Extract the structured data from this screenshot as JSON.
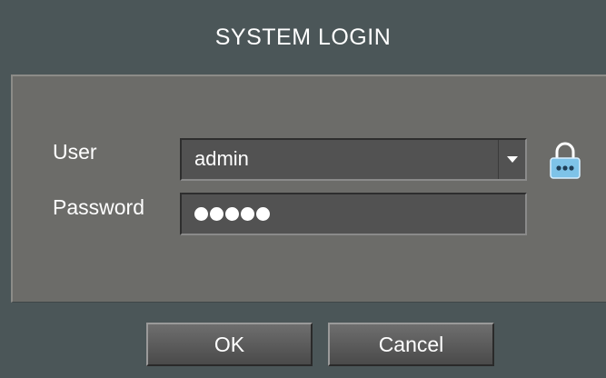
{
  "dialog": {
    "title": "SYSTEM LOGIN"
  },
  "form": {
    "user_label": "User",
    "user_value": "admin",
    "password_label": "Password",
    "password_masked_length": 5
  },
  "buttons": {
    "ok_label": "OK",
    "cancel_label": "Cancel"
  },
  "icons": {
    "dropdown": "chevron-down-icon",
    "lock": "lock-icon"
  },
  "colors": {
    "title_bar": "#4b5658",
    "panel": "#6c6c69",
    "field": "#525252",
    "lock_icon": "#7ec3e8"
  }
}
